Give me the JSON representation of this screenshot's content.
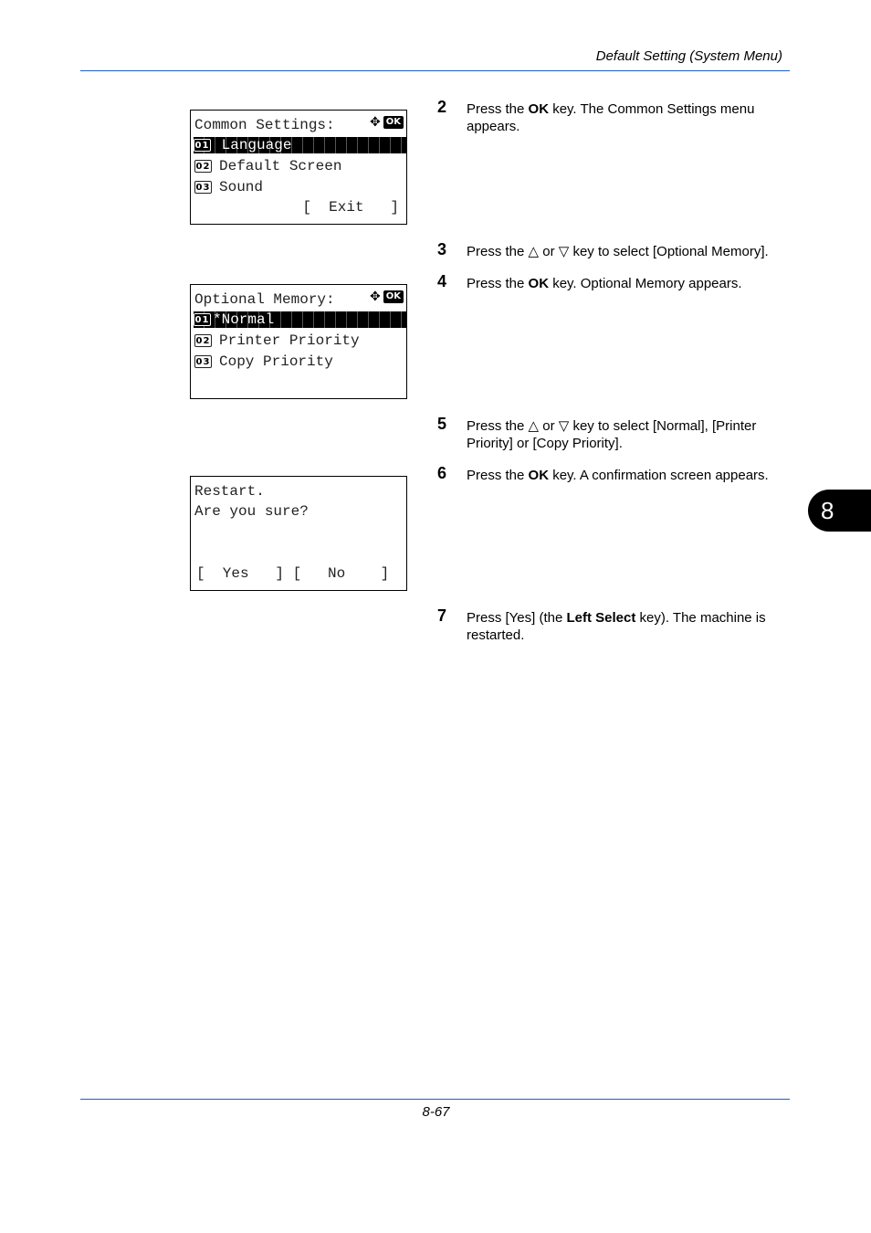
{
  "header": {
    "title": "Default Setting (System Menu)"
  },
  "footer": {
    "page_number": "8-67"
  },
  "chapter_tab": {
    "label": "8"
  },
  "screens": [
    {
      "title": "Common Settings:",
      "nav_icon": "arrow-cross-icon",
      "ok_label": "OK",
      "items": [
        {
          "num": "01",
          "label": "Language",
          "selected": true
        },
        {
          "num": "02",
          "label": "Default Screen"
        },
        {
          "num": "03",
          "label": "Sound"
        }
      ],
      "softkey": "[  Exit   ]"
    },
    {
      "title": "Optional Memory:",
      "nav_icon": "arrow-cross-icon",
      "ok_label": "OK",
      "items": [
        {
          "num": "01",
          "label": "*Normal",
          "selected": true
        },
        {
          "num": "02",
          "label": "Printer Priority"
        },
        {
          "num": "03",
          "label": "Copy Priority"
        }
      ]
    },
    {
      "line1": "Restart.",
      "line2": "Are you sure?",
      "softkeys": "[  Yes   ] [   No    ]"
    }
  ],
  "steps": [
    {
      "num": "2",
      "pre": "Press the ",
      "bold": "OK",
      "post": " key. The Common Settings menu appears."
    },
    {
      "num": "3",
      "text": "Press the △ or ▽ key to select [Optional Memory]."
    },
    {
      "num": "4",
      "pre": "Press the ",
      "bold": "OK",
      "post": " key. Optional Memory appears."
    },
    {
      "num": "5",
      "text": "Press the △ or ▽ key to select [Normal], [Printer Priority] or [Copy Priority]."
    },
    {
      "num": "6",
      "pre": "Press the ",
      "bold": "OK",
      "post": " key. A confirmation screen appears."
    },
    {
      "num": "7",
      "pre": "Press [Yes] (the ",
      "bold": "Left Select",
      "post": " key). The machine is restarted."
    }
  ]
}
